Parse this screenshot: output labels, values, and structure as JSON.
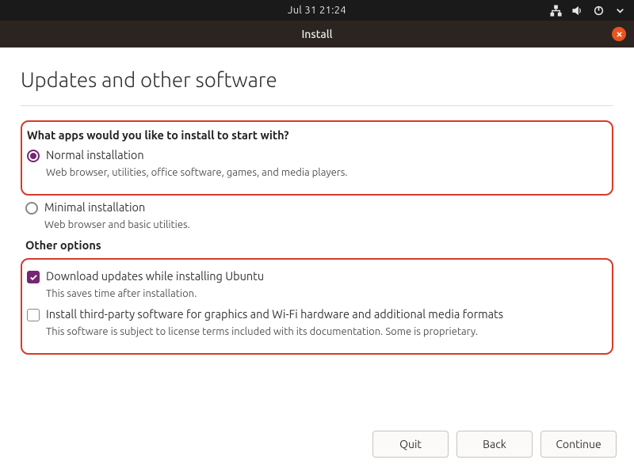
{
  "topbar": {
    "datetime": "Jul 31  21:24"
  },
  "titlebar": {
    "title": "Install"
  },
  "page": {
    "heading": "Updates and other software"
  },
  "apps": {
    "question": "What apps would you like to install to start with?",
    "normal": {
      "label": "Normal installation",
      "desc": "Web browser, utilities, office software, games, and media players."
    },
    "minimal": {
      "label": "Minimal installation",
      "desc": "Web browser and basic utilities."
    }
  },
  "other": {
    "label": "Other options",
    "download": {
      "label": "Download updates while installing Ubuntu",
      "desc": "This saves time after installation."
    },
    "thirdparty": {
      "label": "Install third-party software for graphics and Wi-Fi hardware and additional media formats",
      "desc": "This software is subject to license terms included with its documentation. Some is proprietary."
    }
  },
  "footer": {
    "quit": "Quit",
    "back": "Back",
    "continue": "Continue"
  }
}
